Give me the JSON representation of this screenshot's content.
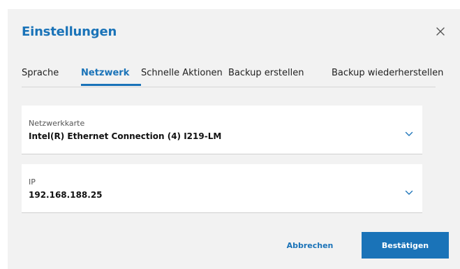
{
  "dialog": {
    "title": "Einstellungen",
    "close_icon": "close-icon"
  },
  "tabs": [
    {
      "label": "Sprache",
      "active": false
    },
    {
      "label": "Netzwerk",
      "active": true
    },
    {
      "label": "Schnelle Aktionen",
      "active": false
    },
    {
      "label": "Backup erstellen",
      "active": false
    },
    {
      "label": "Backup wiederherstellen",
      "active": false
    }
  ],
  "fields": [
    {
      "label": "Netzwerkkarte",
      "value": "Intel(R) Ethernet Connection (4) I219-LM",
      "icon": "chevron-down-icon"
    },
    {
      "label": "IP",
      "value": "192.168.188.25",
      "icon": "chevron-down-icon"
    }
  ],
  "footer": {
    "cancel_label": "Abbrechen",
    "confirm_label": "Bestätigen"
  },
  "colors": {
    "accent": "#1a73b8",
    "dialog_background": "#f2f2f2",
    "field_background": "#ffffff"
  }
}
